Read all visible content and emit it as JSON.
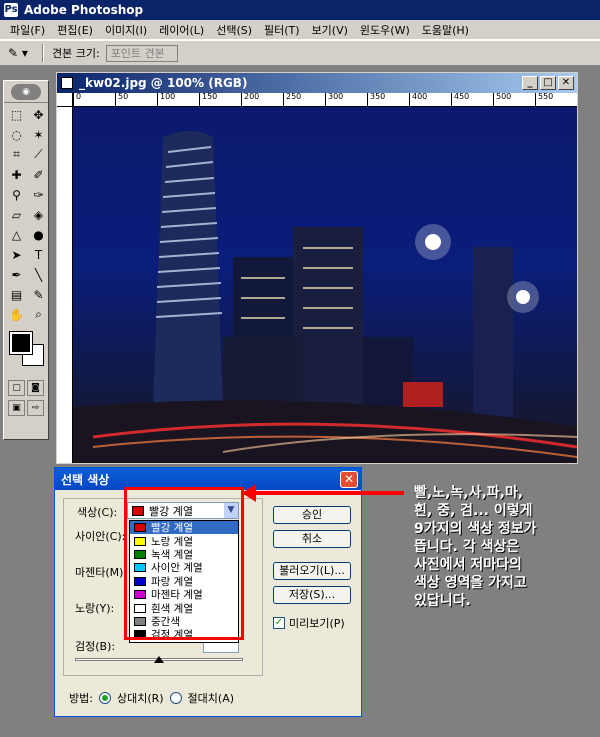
{
  "app": {
    "title": "Adobe Photoshop"
  },
  "menubar": {
    "items": [
      "파일(F)",
      "편집(E)",
      "이미지(I)",
      "레이어(L)",
      "선택(S)",
      "필터(T)",
      "보기(V)",
      "윈도우(W)",
      "도움말(H)"
    ]
  },
  "options": {
    "sample_label": "견본 크기:",
    "sample_value": "포인트 견본"
  },
  "document": {
    "title": "_kw02.jpg @ 100% (RGB)",
    "ruler_ticks": [
      "0",
      "50",
      "100",
      "150",
      "200",
      "250",
      "300",
      "350",
      "400",
      "450",
      "500",
      "550"
    ],
    "watermark": "주쓰다 디지털 이미지센터"
  },
  "dialog": {
    "title": "선택 색상",
    "color_label": "색상(C):",
    "selected_color": "빨강 계열",
    "selected_swatch": "#d40000",
    "options": [
      {
        "label": "빨강 계열",
        "color": "#d40000"
      },
      {
        "label": "노랑 계열",
        "color": "#ffff00"
      },
      {
        "label": "녹색 계열",
        "color": "#008000"
      },
      {
        "label": "사이안 계열",
        "color": "#00c8ff"
      },
      {
        "label": "파랑 계열",
        "color": "#0000c8"
      },
      {
        "label": "마젠타 계열",
        "color": "#d000d0"
      },
      {
        "label": "흰색 계열",
        "color": "#ffffff"
      },
      {
        "label": "중간색",
        "color": "#808080"
      },
      {
        "label": "검정 계열",
        "color": "#000000"
      }
    ],
    "slider_labels": [
      "사이안(C):",
      "마젠타(M):",
      "노랑(Y):",
      "검정(B):"
    ],
    "buttons": {
      "ok": "승인",
      "cancel": "취소",
      "load": "불러오기(L)...",
      "save": "저장(S)..."
    },
    "preview_label": "미리보기(P)",
    "method_label": "방법:",
    "relative_label": "상대치(R)",
    "absolute_label": "절대치(A)"
  },
  "annotation": {
    "text": "빨,노,녹,사,파,마,\n흰, 중, 검... 이렇게\n9가지의 색상 정보가\n뜹니다. 각 색상은\n사진에서 저마다의\n색상 영역을 가지고\n있답니다."
  },
  "colors": {
    "highlight": "#ff0000",
    "selection": "#316ac5"
  }
}
